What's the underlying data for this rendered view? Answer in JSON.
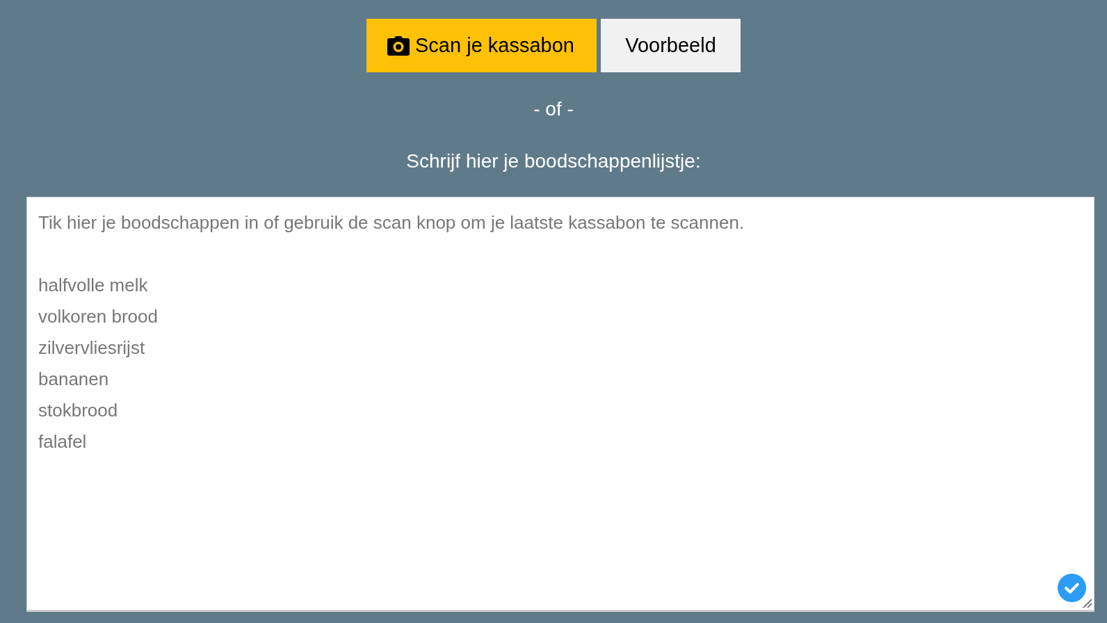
{
  "buttons": [
    {
      "kind": "scan",
      "label": "Scan je kassabon"
    },
    {
      "kind": "example",
      "label": "Voorbeeld"
    }
  ],
  "separator": "- of -",
  "prompt": "Schrijf hier je boodschappenlijstje:",
  "list_field": {
    "placeholder": "Tik hier je boodschappen in of gebruik de scan knop om je laatste kassabon te scannen.\n\nhalfvolle melk\nvolkoren brood\nzilvervliesrijst\nbananen\nstokbrood\nfalafel"
  }
}
